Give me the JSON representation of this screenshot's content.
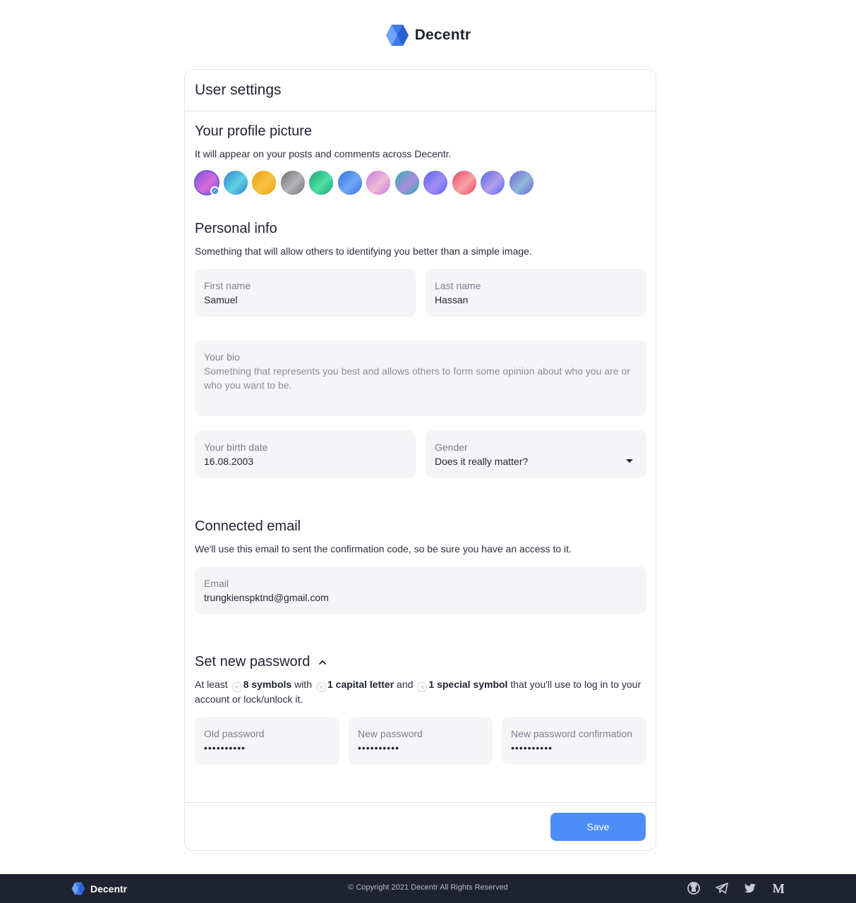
{
  "brand": {
    "name": "Decentr"
  },
  "card": {
    "title": "User settings"
  },
  "profile_picture": {
    "title": "Your profile picture",
    "description": "It will appear on your posts and comments across Decentr.",
    "avatars": [
      {
        "colors": [
          "#7b4fd6",
          "#d66bd9"
        ],
        "selected": true
      },
      {
        "colors": [
          "#2e7bd6",
          "#5fd3e0"
        ],
        "selected": false
      },
      {
        "colors": [
          "#f0a20a",
          "#f6c344"
        ],
        "selected": false
      },
      {
        "colors": [
          "#6e6f74",
          "#b4b5ba"
        ],
        "selected": false
      },
      {
        "colors": [
          "#16a86b",
          "#4fe0a8"
        ],
        "selected": false
      },
      {
        "colors": [
          "#2f6fe0",
          "#73a8f5"
        ],
        "selected": false
      },
      {
        "colors": [
          "#c27be0",
          "#f2b9d8"
        ],
        "selected": false
      },
      {
        "colors": [
          "#2bb3a6",
          "#a88be0"
        ],
        "selected": false
      },
      {
        "colors": [
          "#5a63f0",
          "#a08df5"
        ],
        "selected": false
      },
      {
        "colors": [
          "#e8436b",
          "#f7a3a3"
        ],
        "selected": false
      },
      {
        "colors": [
          "#5467e6",
          "#b39ef0"
        ],
        "selected": false
      },
      {
        "colors": [
          "#6d63d6",
          "#8fb9d8"
        ],
        "selected": false
      }
    ]
  },
  "personal_info": {
    "title": "Personal info",
    "description": "Something that will allow others to identifying you better than a simple image.",
    "first_name": {
      "label": "First name",
      "value": "Samuel"
    },
    "last_name": {
      "label": "Last name",
      "value": "Hassan"
    },
    "bio": {
      "label": "Your bio",
      "placeholder": "Something that represents you best and allows others to form some opinion about who you are or who you want to be."
    },
    "birth_date": {
      "label": "Your birth date",
      "value": "16.08.2003"
    },
    "gender": {
      "label": "Gender",
      "value": "Does it really matter?"
    }
  },
  "email": {
    "title": "Connected email",
    "description": "We'll use this email to sent the confirmation code, so be sure you have an access to it.",
    "field": {
      "label": "Email",
      "value": "trungkienspktnd@gmail.com"
    }
  },
  "password": {
    "title": "Set new password",
    "req_prefix": "At least",
    "req_1": "8 symbols",
    "req_with": "with",
    "req_2": "1 capital letter",
    "req_and": "and",
    "req_3": "1 special symbol",
    "req_suffix": "that you'll use to log in to your account or lock/unlock it.",
    "old": {
      "label": "Old password",
      "value": "••••••••••"
    },
    "new": {
      "label": "New password",
      "value": "••••••••••"
    },
    "confirm": {
      "label": "New password confirmation",
      "value": "••••••••••"
    }
  },
  "actions": {
    "save_label": "Save"
  },
  "footer": {
    "brand": "Decentr",
    "copyright": "© Copyright 2021 Decentr All Rights Reserved",
    "social": [
      "github-icon",
      "telegram-icon",
      "twitter-icon",
      "medium-icon"
    ]
  },
  "colors": {
    "accent": "#4c8df6",
    "field_bg": "#f5f5f7",
    "footer_bg": "#1f2230"
  }
}
